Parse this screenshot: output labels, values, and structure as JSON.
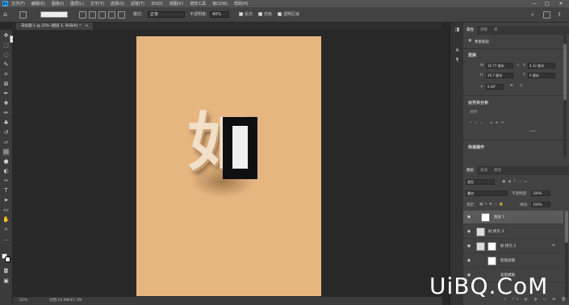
{
  "menubar": {
    "logo": "Ps",
    "items": [
      "文件(F)",
      "编辑(E)",
      "图像(I)",
      "图层(L)",
      "文字(Y)",
      "选择(S)",
      "滤镜(T)",
      "3D(D)",
      "视图(V)",
      "增效工具",
      "窗口(W)",
      "帮助(H)"
    ],
    "minimize": "—",
    "maximize": "□",
    "close": "✕"
  },
  "options": {
    "mode_label": "模式:",
    "mode_value": "正常",
    "opacity_label": "不透明度:",
    "opacity_value": "40%",
    "reverse_label": "反向",
    "dither_label": "仿色",
    "transparency_label": "透明区域"
  },
  "document": {
    "tab_title": "未标题-1 @ 25% (图层 1, RGB/8) *",
    "tab_close": "×",
    "glyph_left": "如",
    "zoom": "25%",
    "doc_info": "文档:24.9M/45.7M"
  },
  "toolbox": {
    "tooltip": "Alt"
  },
  "properties": {
    "tabs": [
      "属性",
      "调整",
      "库"
    ],
    "doc_type": "像素图层",
    "transform_title": "变换",
    "w_label": "W",
    "w_value": "16.77 厘米",
    "x_label": "X",
    "x_value": "4.22 厘米",
    "h_label": "H",
    "h_value": "26.7 厘米",
    "y_label": "Y",
    "y_value": "0 厘米",
    "angle_value": "0.00°",
    "align_title": "对齐并分布",
    "align_label": "对齐:",
    "quick_title": "快速操作",
    "more": "•••"
  },
  "layers": {
    "tabs": [
      "图层",
      "通道",
      "路径"
    ],
    "filter_kind": "类型",
    "blend_mode": "叠加",
    "opacity_label": "不透明度:",
    "opacity_value": "100%",
    "lock_label": "锁定:",
    "fill_label": "填充:",
    "fill_value": "100%",
    "rows": [
      {
        "name": "图层 1"
      },
      {
        "name": "如 拷贝 3"
      },
      {
        "name": "如 拷贝 2"
      },
      {
        "name": "智能滤镜"
      },
      {
        "name": "高斯模糊"
      }
    ]
  },
  "watermark": "UiBQ.CoM"
}
